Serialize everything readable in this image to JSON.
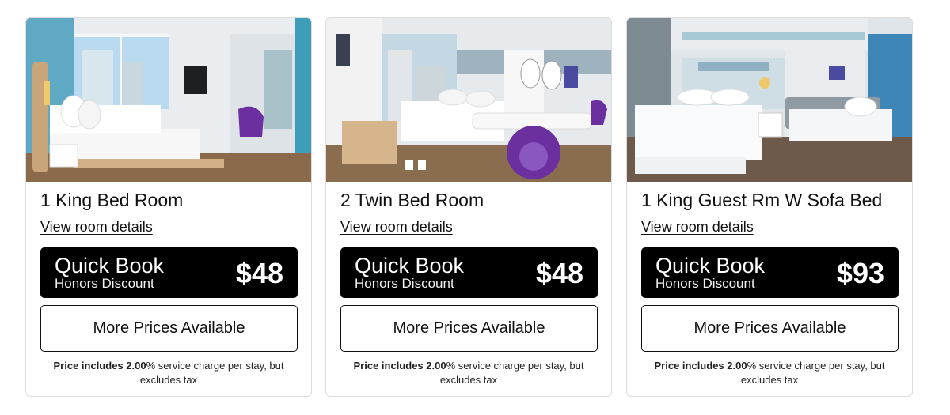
{
  "rooms": [
    {
      "title": "1 King Bed Room",
      "details_link": "View room details",
      "quick_book": {
        "title": "Quick Book",
        "subtitle": "Honors Discount",
        "price": "$48"
      },
      "more_prices": "More Prices Available",
      "fine_print": {
        "lead": "Price includes",
        "rate": "2.00",
        "rest": "% service charge per stay, but excludes tax"
      }
    },
    {
      "title": "2 Twin Bed Room",
      "details_link": "View room details",
      "quick_book": {
        "title": "Quick Book",
        "subtitle": "Honors Discount",
        "price": "$48"
      },
      "more_prices": "More Prices Available",
      "fine_print": {
        "lead": "Price includes",
        "rate": "2.00",
        "rest": "% service charge per stay, but excludes tax"
      }
    },
    {
      "title": "1 King Guest Rm W Sofa Bed",
      "details_link": "View room details",
      "quick_book": {
        "title": "Quick Book",
        "subtitle": "Honors Discount",
        "price": "$93"
      },
      "more_prices": "More Prices Available",
      "fine_print": {
        "lead": "Price includes",
        "rate": "2.00",
        "rest": "% service charge per stay, but excludes tax"
      }
    }
  ],
  "colors": {
    "quick_book_bg": "#000000",
    "accent_purple": "#6b2fa0",
    "accent_teal": "#4fb3c9"
  }
}
